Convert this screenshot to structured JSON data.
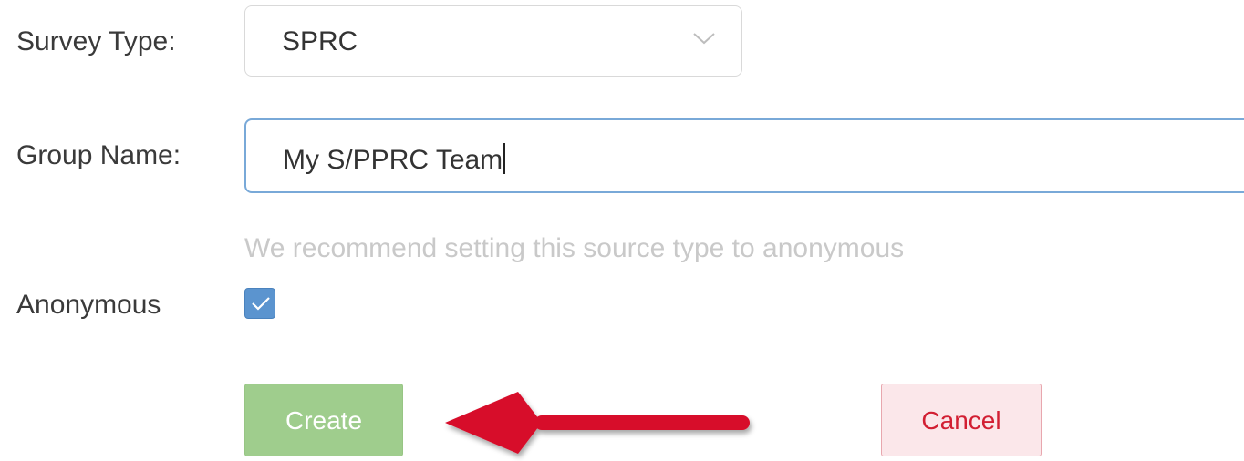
{
  "form": {
    "survey_type": {
      "label": "Survey Type:",
      "value": "SPRC",
      "icon": "chevron-down-icon"
    },
    "group_name": {
      "label": "Group Name:",
      "value": "My S/PPRC Team"
    },
    "hint": "We recommend setting this source type to anonymous",
    "anonymous": {
      "label": "Anonymous",
      "checked": true,
      "icon": "checkmark-icon"
    },
    "actions": {
      "create_label": "Create",
      "cancel_label": "Cancel"
    }
  },
  "annotation": {
    "icon": "red-arrow-icon",
    "color": "#d70c2a"
  },
  "colors": {
    "focus_border": "#79a9d8",
    "checkbox": "#5b94cf",
    "create_button": "#9fcd8d",
    "cancel_text": "#d21f33",
    "cancel_bg": "#fbe7ea",
    "hint_text": "#c9c9c9"
  }
}
